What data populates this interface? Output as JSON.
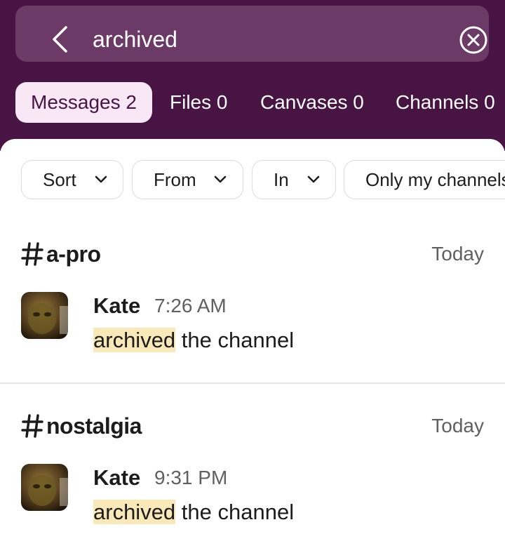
{
  "search": {
    "query": "archived"
  },
  "tabs": [
    {
      "label": "Messages 2",
      "active": true
    },
    {
      "label": "Files 0",
      "active": false
    },
    {
      "label": "Canvases 0",
      "active": false
    },
    {
      "label": "Channels 0",
      "active": false
    }
  ],
  "filters": [
    {
      "label": "Sort"
    },
    {
      "label": "From"
    },
    {
      "label": "In"
    },
    {
      "label": "Only my channels"
    }
  ],
  "results": [
    {
      "channel": "a-pro",
      "date": "Today",
      "author": "Kate",
      "time": "7:26 AM",
      "highlight": "archived",
      "text": " the channel"
    },
    {
      "channel": "nostalgia",
      "date": "Today",
      "author": "Kate",
      "time": "9:31 PM",
      "highlight": "archived",
      "text": " the channel"
    }
  ],
  "colors": {
    "header_bg": "#481444",
    "search_bg": "#6c3a67",
    "active_tab_bg": "#f8e8f6",
    "highlight": "#f9e8b8"
  },
  "icons": [
    "back-arrow-icon",
    "clear-search-icon",
    "chevron-down-icon",
    "hash-icon"
  ]
}
